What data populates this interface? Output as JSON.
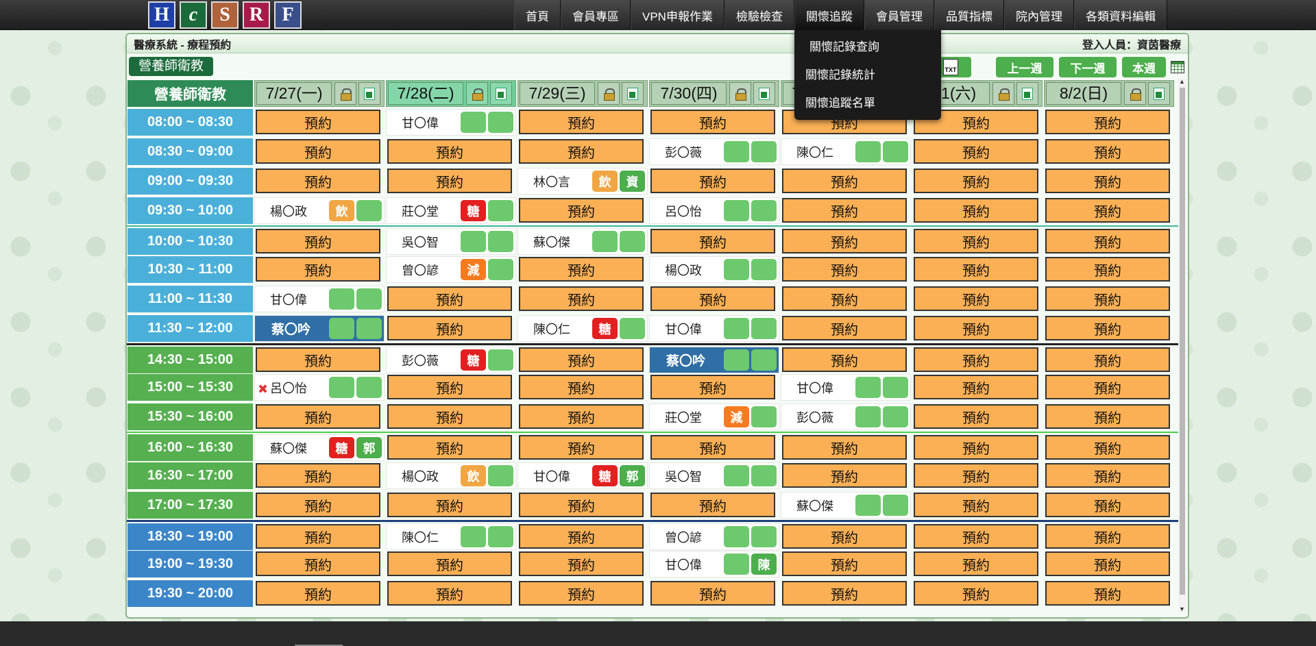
{
  "logos": [
    {
      "letter": "H",
      "color": "#1e3fa8",
      "name": "logo-h"
    },
    {
      "letter": "c",
      "color": "#1b6b3a",
      "name": "logo-c"
    },
    {
      "letter": "S",
      "color": "#b0623a",
      "name": "logo-s"
    },
    {
      "letter": "R",
      "color": "#a81a4a",
      "name": "logo-r"
    },
    {
      "letter": "F",
      "color": "#3a4f8a",
      "name": "logo-f"
    }
  ],
  "nav": [
    "首頁",
    "會員專區",
    "VPN申報作業",
    "檢驗檢查",
    "關懷追蹤",
    "會員管理",
    "品質指標",
    "院內管理",
    "各類資料編輯"
  ],
  "dropdown": [
    "關懷記錄查詢",
    "關懷記錄統計",
    "關懷追蹤名單"
  ],
  "panel": {
    "title": "醫療系統 - 療程預約",
    "user": "登入人員：資茵醫療"
  },
  "toolbar": {
    "teacher": "營養師衛教",
    "prev": "上一週",
    "next": "下一週",
    "this_week": "本週",
    "txt_label": "TXT"
  },
  "grid": {
    "corner": "營養師衛教",
    "days": [
      "7/27(一)",
      "7/28(二)",
      "7/29(三)",
      "7/30(四)",
      "7/31(五)",
      "8/1(六)",
      "8/2(日)"
    ],
    "book_label": "預約",
    "rows": [
      {
        "time": "08:00 ~ 08:30",
        "color": "blue",
        "cells": [
          null,
          {
            "n": "甘〇偉",
            "t": [
              "",
              ""
            ]
          },
          null,
          null,
          null,
          null,
          null
        ]
      },
      {
        "time": "08:30 ~ 09:00",
        "color": "blue",
        "cells": [
          null,
          null,
          null,
          {
            "n": "彭〇薇",
            "t": [
              "",
              ""
            ]
          },
          {
            "n": "陳〇仁",
            "t": [
              "",
              ""
            ]
          },
          null,
          null
        ]
      },
      {
        "time": "09:00 ~ 09:30",
        "color": "blue",
        "cells": [
          null,
          null,
          {
            "n": "林〇言",
            "t": [
              "飲",
              "資"
            ]
          },
          null,
          null,
          null,
          null
        ]
      },
      {
        "time": "09:30 ~ 10:00",
        "color": "blue",
        "cells": [
          {
            "n": "楊〇政",
            "t": [
              "飲",
              ""
            ]
          },
          {
            "n": "莊〇堂",
            "t": [
              "糖",
              ""
            ]
          },
          null,
          {
            "n": "呂〇怡",
            "t": [
              "",
              ""
            ]
          },
          null,
          null,
          null
        ]
      },
      {
        "time": "10:00 ~ 10:30",
        "color": "blue",
        "sep": "teal",
        "cells": [
          null,
          {
            "n": "吳〇智",
            "t": [
              "",
              ""
            ]
          },
          {
            "n": "蘇〇傑",
            "t": [
              "",
              ""
            ]
          },
          null,
          null,
          null,
          null
        ]
      },
      {
        "time": "10:30 ~ 11:00",
        "color": "blue",
        "cells": [
          null,
          {
            "n": "曾〇諺",
            "t": [
              "減",
              ""
            ]
          },
          null,
          {
            "n": "楊〇政",
            "t": [
              "",
              ""
            ]
          },
          null,
          null,
          null
        ]
      },
      {
        "time": "11:00 ~ 11:30",
        "color": "blue",
        "cells": [
          {
            "n": "甘〇偉",
            "t": [
              "",
              ""
            ]
          },
          null,
          null,
          null,
          null,
          null,
          null
        ]
      },
      {
        "time": "11:30 ~ 12:00",
        "color": "blue",
        "cells": [
          {
            "n": "蔡〇吟",
            "t": [
              "",
              ""
            ],
            "hl": true
          },
          null,
          {
            "n": "陳〇仁",
            "t": [
              "糖",
              ""
            ]
          },
          {
            "n": "甘〇偉",
            "t": [
              "",
              ""
            ]
          },
          null,
          null,
          null
        ]
      },
      {
        "time": "14:30 ~ 15:00",
        "color": "green",
        "sep": "dark",
        "cells": [
          null,
          {
            "n": "彭〇薇",
            "t": [
              "糖",
              ""
            ]
          },
          null,
          {
            "n": "蔡〇吟",
            "t": [
              "",
              ""
            ],
            "hl": true
          },
          null,
          null,
          null
        ]
      },
      {
        "time": "15:00 ~ 15:30",
        "color": "green",
        "cells": [
          {
            "n": "呂〇怡",
            "t": [
              "",
              ""
            ],
            "x": true
          },
          null,
          null,
          null,
          {
            "n": "甘〇偉",
            "t": [
              "",
              ""
            ]
          },
          null,
          null
        ]
      },
      {
        "time": "15:30 ~ 16:00",
        "color": "green",
        "cells": [
          null,
          null,
          null,
          {
            "n": "莊〇堂",
            "t": [
              "減",
              ""
            ]
          },
          {
            "n": "彭〇薇",
            "t": [
              "",
              ""
            ]
          },
          null,
          null
        ]
      },
      {
        "time": "16:00 ~ 16:30",
        "color": "green",
        "sep": "green",
        "cells": [
          {
            "n": "蘇〇傑",
            "t": [
              "糖",
              "郭"
            ]
          },
          null,
          null,
          null,
          null,
          null,
          null
        ]
      },
      {
        "time": "16:30 ~ 17:00",
        "color": "green",
        "cells": [
          null,
          {
            "n": "楊〇政",
            "t": [
              "飲",
              ""
            ]
          },
          {
            "n": "甘〇偉",
            "t": [
              "糖",
              "郭"
            ]
          },
          {
            "n": "吳〇智",
            "t": [
              "",
              ""
            ]
          },
          null,
          null,
          null
        ]
      },
      {
        "time": "17:00 ~ 17:30",
        "color": "green",
        "cells": [
          null,
          null,
          null,
          null,
          {
            "n": "蘇〇傑",
            "t": [
              "",
              ""
            ]
          },
          null,
          null
        ]
      },
      {
        "time": "18:30 ~ 19:00",
        "color": "dblue",
        "sep": "blue",
        "cells": [
          null,
          {
            "n": "陳〇仁",
            "t": [
              "",
              ""
            ]
          },
          null,
          {
            "n": "曾〇諺",
            "t": [
              "",
              ""
            ]
          },
          null,
          null,
          null
        ]
      },
      {
        "time": "19:00 ~ 19:30",
        "color": "dblue",
        "cells": [
          null,
          null,
          null,
          {
            "n": "甘〇偉",
            "t": [
              "",
              "陳"
            ]
          },
          null,
          null,
          null
        ]
      },
      {
        "time": "19:30 ~ 20:00",
        "color": "dblue",
        "cells": [
          null,
          null,
          null,
          null,
          null,
          null,
          null
        ]
      }
    ]
  }
}
